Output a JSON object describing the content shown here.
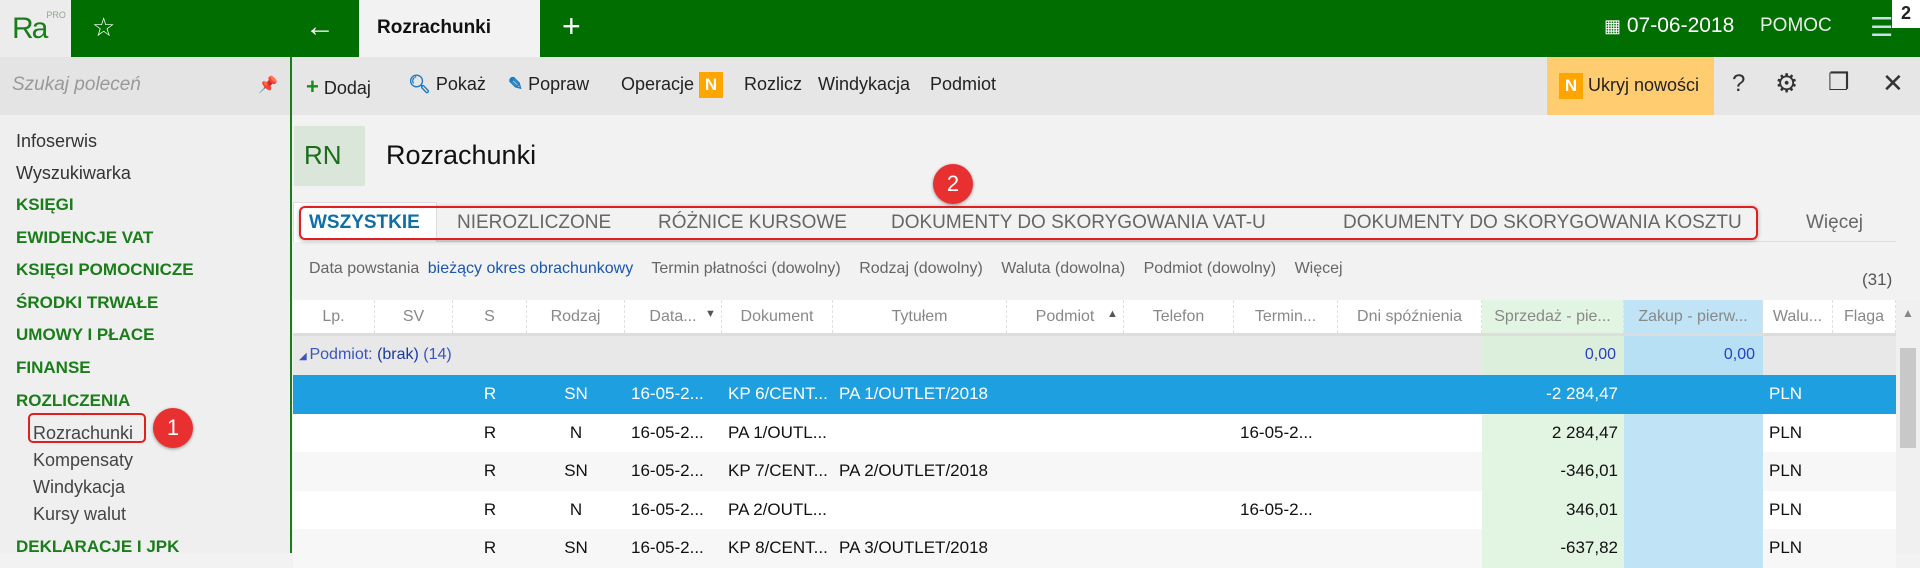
{
  "app": {
    "logo": "Ra",
    "logo_sup": "PRO",
    "tab_title": "Rozrachunki",
    "date": "07-06-2018",
    "help": "POMOC",
    "corner_badge": "2"
  },
  "sidebar": {
    "search_placeholder": "Szukaj poleceń",
    "items": [
      {
        "label": "Infoserwis",
        "type": "item"
      },
      {
        "label": "Wyszukiwarka",
        "type": "item"
      },
      {
        "label": "KSIĘGI",
        "type": "sec"
      },
      {
        "label": "EWIDENCJE VAT",
        "type": "sec"
      },
      {
        "label": "KSIĘGI POMOCNICZE",
        "type": "sec"
      },
      {
        "label": "ŚRODKI TRWAŁE",
        "type": "sec"
      },
      {
        "label": "UMOWY I PŁACE",
        "type": "sec"
      },
      {
        "label": "FINANSE",
        "type": "sec"
      },
      {
        "label": "ROZLICZENIA",
        "type": "sec"
      },
      {
        "label": "Rozrachunki",
        "type": "sub"
      },
      {
        "label": "Kompensaty",
        "type": "sub"
      },
      {
        "label": "Windykacja",
        "type": "sub"
      },
      {
        "label": "Kursy walut",
        "type": "sub"
      },
      {
        "label": "DEKLARACJE I JPK",
        "type": "sec"
      }
    ]
  },
  "toolbar": {
    "add": "Dodaj",
    "show": "Pokaż",
    "edit": "Popraw",
    "operations": "Operacje",
    "new_badge": "N",
    "settle": "Rozlicz",
    "collection": "Windykacja",
    "entity": "Podmiot",
    "hide_news": "Ukryj nowości"
  },
  "page": {
    "code": "RN",
    "title": "Rozrachunki"
  },
  "annotations": {
    "one": "1",
    "two": "2"
  },
  "tabs": [
    "WSZYSTKIE",
    "NIEROZLICZONE",
    "RÓŻNICE KURSOWE",
    "DOKUMENTY DO SKORYGOWANIA VAT-U",
    "DOKUMENTY DO SKORYGOWANIA KOSZTU",
    "Więcej"
  ],
  "filters": {
    "created_label": "Data powstania",
    "created_value": "bieżący okres obrachunkowy",
    "due": "Termin płatności (dowolny)",
    "kind": "Rodzaj (dowolny)",
    "currency": "Waluta (dowolna)",
    "entity": "Podmiot (dowolny)",
    "more": "Więcej",
    "count": "(31)"
  },
  "grid": {
    "columns": [
      "Lp.",
      "SV",
      "S",
      "Rodzaj",
      "Data...",
      "Dokument",
      "Tytułem",
      "Podmiot",
      "Telefon",
      "Termin...",
      "Dni spóźnienia",
      "Sprzedaż - pie...",
      "Zakup - pierw...",
      "Walu...",
      "Flaga"
    ],
    "group": {
      "label": "Podmiot:",
      "value": "(brak)",
      "count": "(14)",
      "sales": "0,00",
      "purchase": "0,00"
    },
    "rows": [
      {
        "s": "R",
        "kind": "SN",
        "date": "16-05-2...",
        "doc": "KP 6/CENT...",
        "title": "PA 1/OUTLET/2018",
        "due": "",
        "sales": "-2 284,47",
        "cur": "PLN",
        "selected": true
      },
      {
        "s": "R",
        "kind": "N",
        "date": "16-05-2...",
        "doc": "PA 1/OUTL...",
        "title": "",
        "due": "16-05-2...",
        "sales": "2 284,47",
        "cur": "PLN"
      },
      {
        "s": "R",
        "kind": "SN",
        "date": "16-05-2...",
        "doc": "KP 7/CENT...",
        "title": "PA 2/OUTLET/2018",
        "due": "",
        "sales": "-346,01",
        "cur": "PLN"
      },
      {
        "s": "R",
        "kind": "N",
        "date": "16-05-2...",
        "doc": "PA 2/OUTL...",
        "title": "",
        "due": "16-05-2...",
        "sales": "346,01",
        "cur": "PLN"
      },
      {
        "s": "R",
        "kind": "SN",
        "date": "16-05-2...",
        "doc": "KP 8/CENT...",
        "title": "PA 3/OUTLET/2018",
        "due": "",
        "sales": "-637,82",
        "cur": "PLN"
      }
    ]
  },
  "colors": {
    "brand": "#006e00",
    "section": "#1a7d1a",
    "selected": "#1ea0e0",
    "sales_col": "#e2f4e2",
    "purchase_col": "#c0e4f6",
    "news": "#ffcd70"
  }
}
